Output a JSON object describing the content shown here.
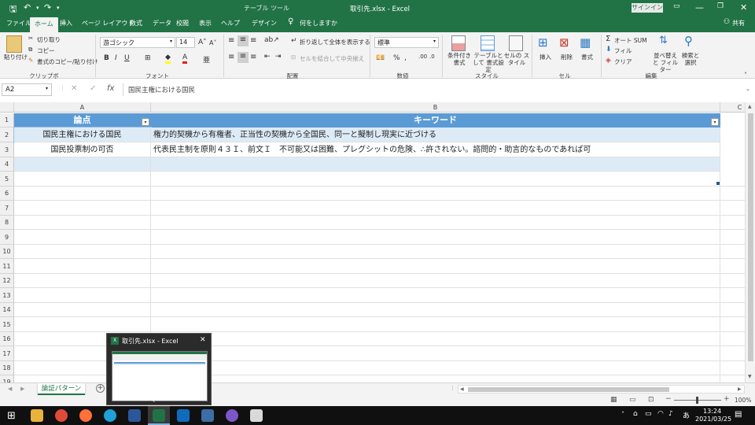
{
  "title": {
    "file": "取引先.xlsx  -  Excel",
    "context_tool": "テーブル ツール",
    "signin": "サインイン"
  },
  "tabs": [
    "ファイル",
    "ホーム",
    "挿入",
    "ページ レイアウト",
    "数式",
    "データ",
    "校閲",
    "表示",
    "ヘルプ",
    "デザイン"
  ],
  "tell_me": "何をしますか",
  "share": "共有",
  "ribbon": {
    "paste": "貼り付け",
    "cut": "切り取り",
    "copy": "コピー",
    "format_painter": "書式のコピー/貼り付け",
    "clipboard": "クリップボード",
    "font_name": "游ゴシック",
    "font_size": "14",
    "font": "フォント",
    "wrap_text": "折り返して全体を表示する",
    "merge_center": "セルを結合して中央揃え",
    "alignment": "配置",
    "number_format": "標準",
    "number": "数値",
    "cond_format": "条件付き 書式",
    "format_table": "テーブルとして 書式設定",
    "cell_styles": "セルの スタイル",
    "styles": "スタイル",
    "insert": "挿入",
    "delete": "削除",
    "format": "書式",
    "cells": "セル",
    "autosum": "オート SUM",
    "fill": "フィル",
    "clear": "クリア",
    "sort_filter": "並べ替えと フィルター",
    "find_select": "検索と 選択",
    "editing": "編集"
  },
  "namebox": "A2",
  "formula": "国民主権における国民",
  "columns": [
    "A",
    "B",
    "C"
  ],
  "rows": [
    "1",
    "2",
    "3",
    "4",
    "5",
    "6",
    "7",
    "8",
    "9",
    "10",
    "11",
    "12",
    "13",
    "14",
    "15",
    "16",
    "17",
    "18",
    "19"
  ],
  "table": {
    "headers": [
      "論点",
      "キーワード"
    ],
    "rows": [
      [
        "国民主権における国民",
        "権力的契機から有権者、正当性の契機から全国民、同一と擬制し現実に近づける"
      ],
      [
        "国民投票制の可否",
        "代表民主制を原則４３Ｉ、前文Ｉ　不可能又は困難、プレグシットの危険、∴許されない。諮問的・助言的なものであれば可"
      ],
      [
        "",
        ""
      ]
    ]
  },
  "sheet_tab": "論証パターン",
  "zoom": "100%",
  "popup_title": "取引先.xlsx - Excel",
  "clock": {
    "time": "13:24",
    "date": "2021/03/25"
  },
  "ime": "あ",
  "colors": {
    "excel_green": "#217346",
    "table_header": "#5b9bd5",
    "band": "#ddebf7",
    "taskbar": "#101010"
  }
}
